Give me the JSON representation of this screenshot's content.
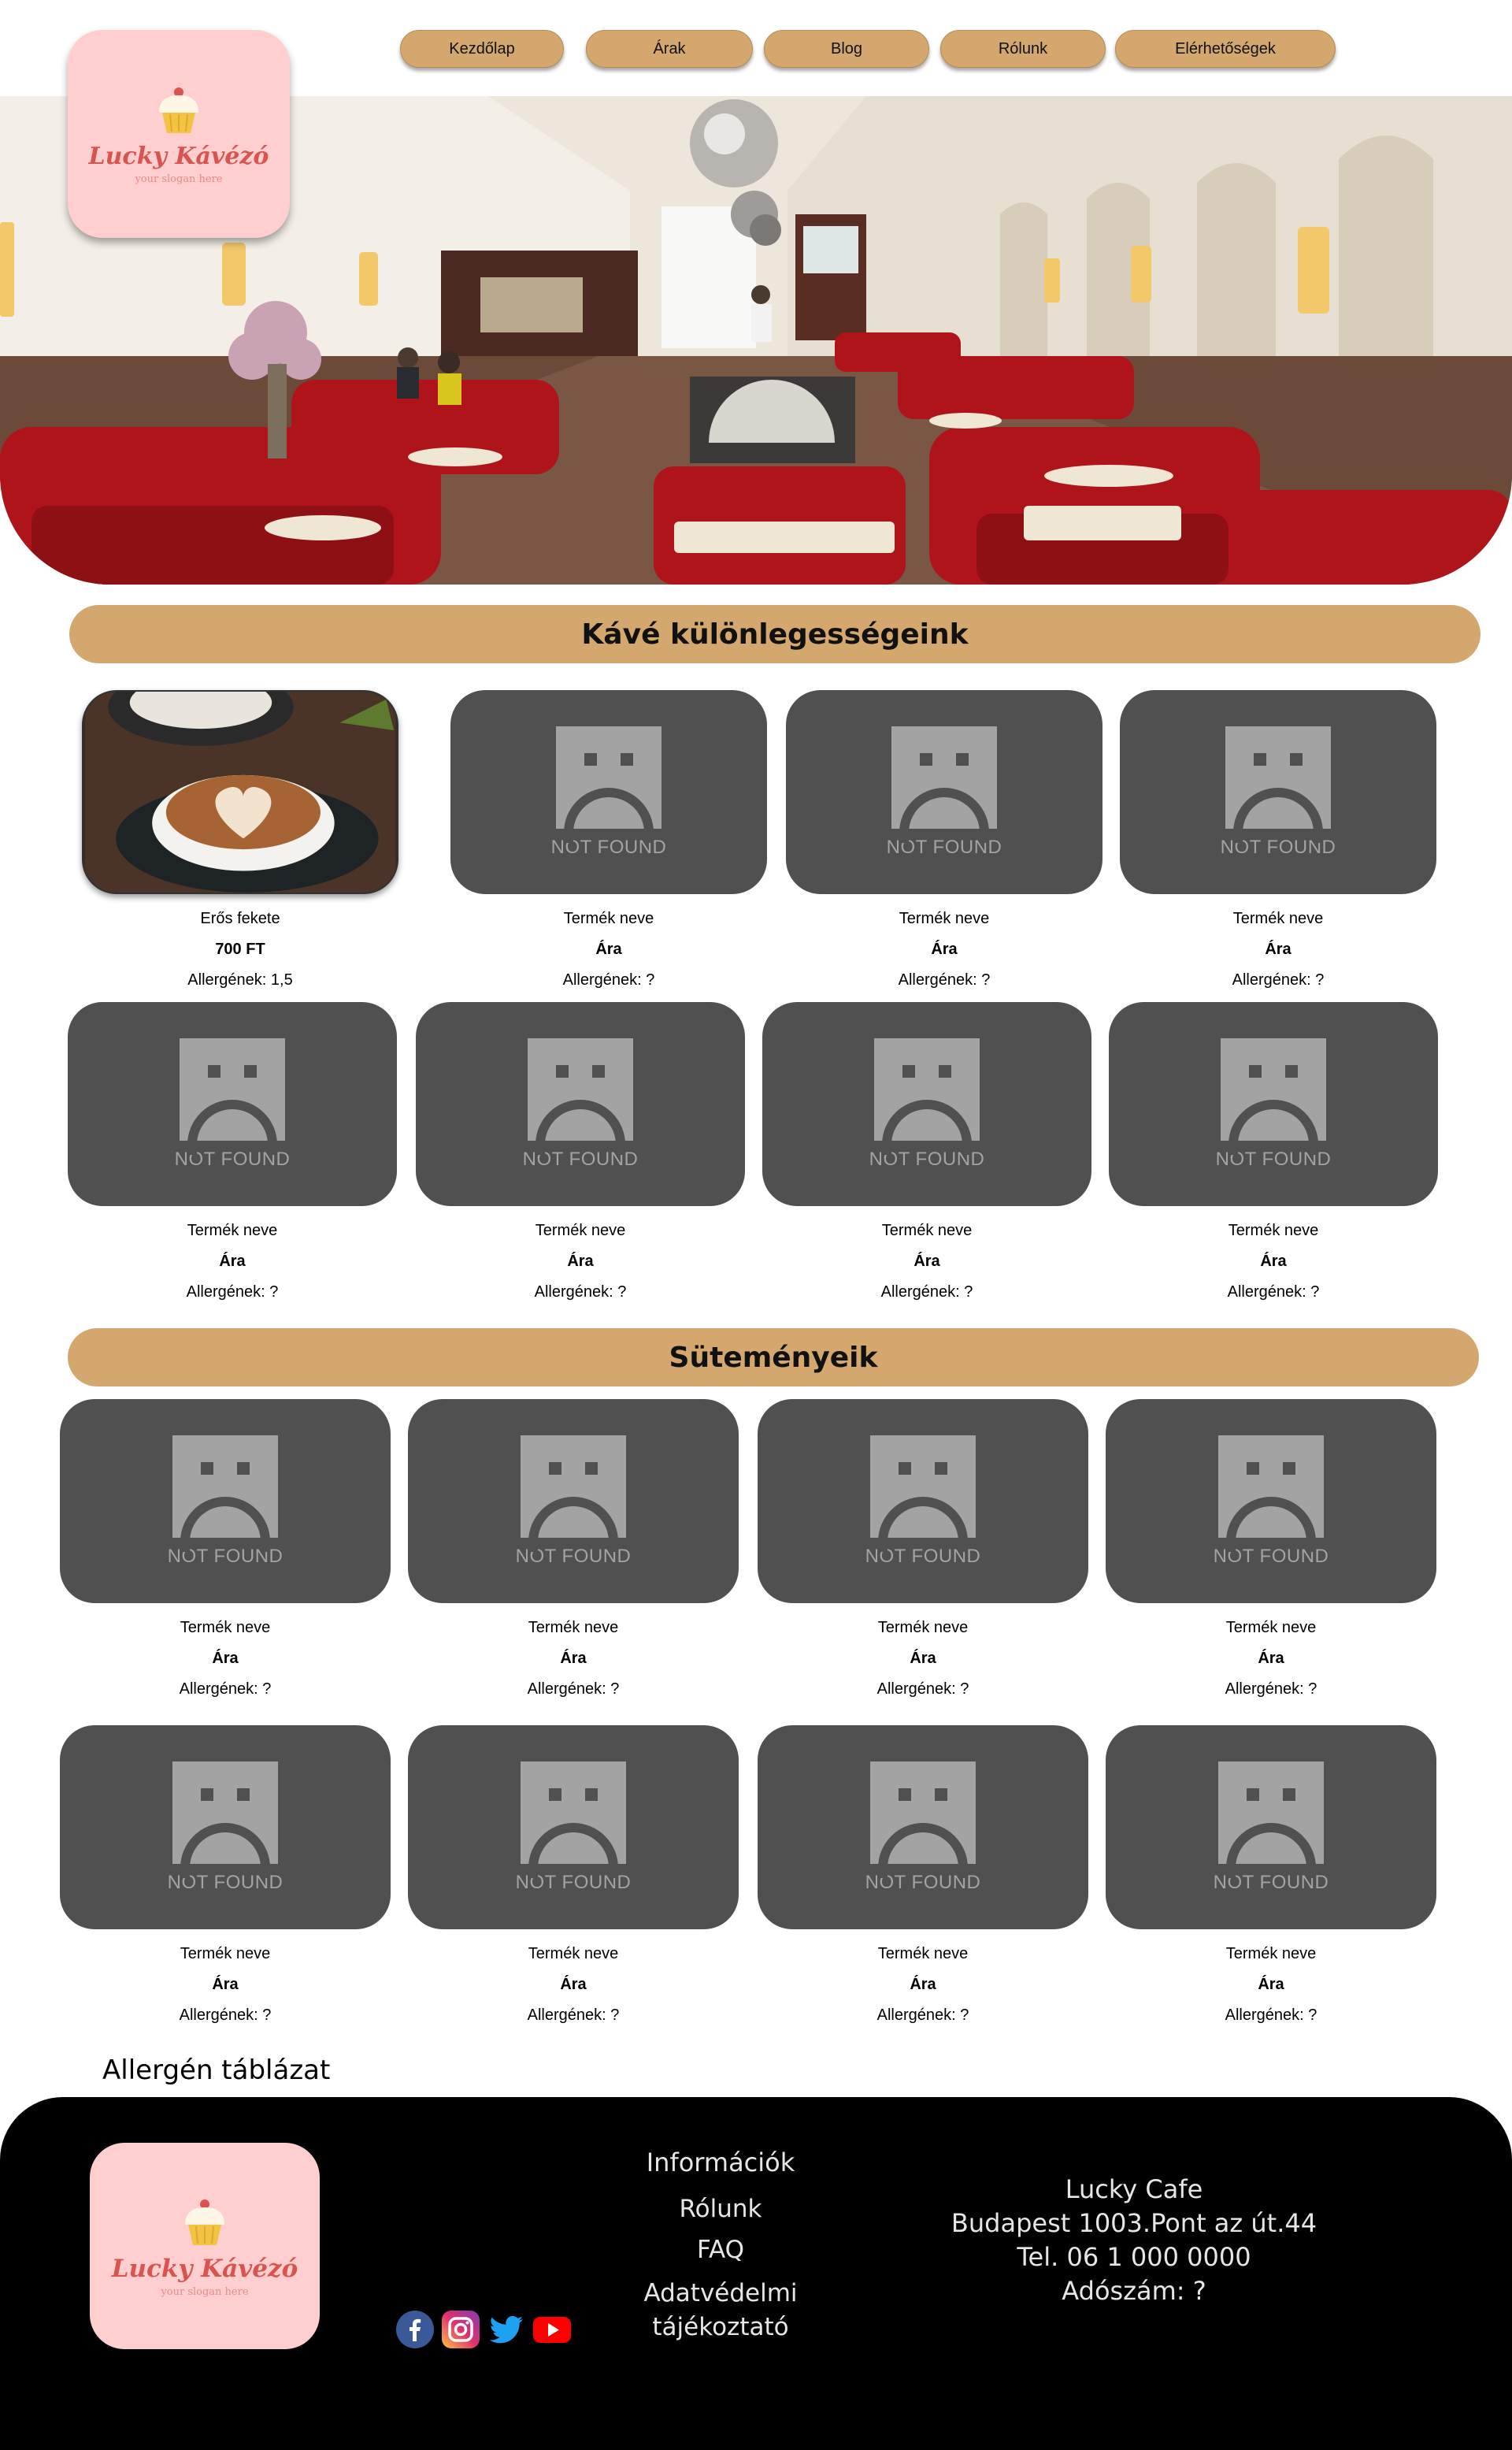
{
  "brand": {
    "name": "Lucky Kávézó",
    "slogan": "your slogan here"
  },
  "nav": {
    "items": [
      {
        "label": "Kezdőlap"
      },
      {
        "label": "Árak"
      },
      {
        "label": "Blog"
      },
      {
        "label": "Rólunk"
      },
      {
        "label": "Elérhetőségek"
      }
    ]
  },
  "colors": {
    "accent": "#d4a76e",
    "logo_bg": "#ffcfcf",
    "card_placeholder": "#505050",
    "footer_bg": "#000000"
  },
  "placeholder_text": "NOT FOUND",
  "coffee": {
    "title": "Kávé különlegességeink",
    "items": [
      {
        "name": "Erős fekete",
        "price": "700 FT",
        "allergens": "Allergének: 1,5",
        "image": "cappuccino-photo"
      },
      {
        "name": "Termék neve",
        "price": "Ára",
        "allergens": "Allergének: ?"
      },
      {
        "name": "Termék neve",
        "price": "Ára",
        "allergens": "Allergének: ?"
      },
      {
        "name": "Termék neve",
        "price": "Ára",
        "allergens": "Allergének: ?"
      },
      {
        "name": "Termék neve",
        "price": "Ára",
        "allergens": "Allergének: ?"
      },
      {
        "name": "Termék neve",
        "price": "Ára",
        "allergens": "Allergének: ?"
      },
      {
        "name": "Termék neve",
        "price": "Ára",
        "allergens": "Allergének: ?"
      },
      {
        "name": "Termék neve",
        "price": "Ára",
        "allergens": "Allergének: ?"
      }
    ]
  },
  "pastries": {
    "title": "Süteményeik",
    "items": [
      {
        "name": "Termék neve",
        "price": "Ára",
        "allergens": "Allergének: ?"
      },
      {
        "name": "Termék neve",
        "price": "Ára",
        "allergens": "Allergének: ?"
      },
      {
        "name": "Termék neve",
        "price": "Ára",
        "allergens": "Allergének: ?"
      },
      {
        "name": "Termék neve",
        "price": "Ára",
        "allergens": "Allergének: ?"
      },
      {
        "name": "Termék neve",
        "price": "Ára",
        "allergens": "Allergének: ?"
      },
      {
        "name": "Termék neve",
        "price": "Ára",
        "allergens": "Allergének: ?"
      },
      {
        "name": "Termék neve",
        "price": "Ára",
        "allergens": "Allergének: ?"
      },
      {
        "name": "Termék neve",
        "price": "Ára",
        "allergens": "Allergének: ?"
      }
    ]
  },
  "allergen_table_link": "Allergén táblázat",
  "footer": {
    "info_title": "Információk",
    "links": [
      "Rólunk",
      "FAQ",
      "Adatvédelmi tájékoztató"
    ],
    "contact": {
      "name": "Lucky Cafe",
      "address": "Budapest 1003.Pont az út.44",
      "phone": "Tel. 06 1 000 0000",
      "tax": "Adószám: ?"
    },
    "social_icons": [
      "facebook-icon",
      "instagram-icon",
      "twitter-icon",
      "youtube-icon"
    ]
  }
}
